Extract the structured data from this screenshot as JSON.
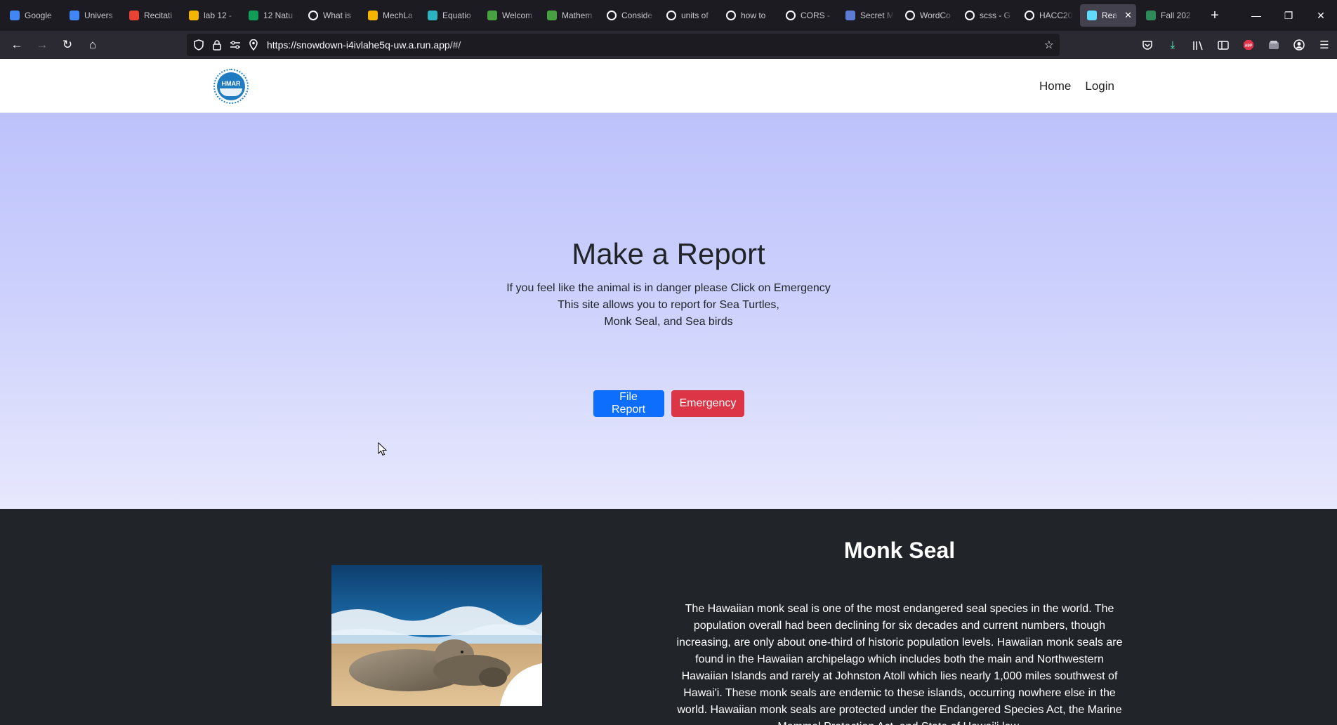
{
  "browser": {
    "tabs": [
      {
        "label": "Google",
        "icon": "google-docs-icon",
        "color": "#4285f4"
      },
      {
        "label": "Univers",
        "icon": "google-docs-icon",
        "color": "#4285f4"
      },
      {
        "label": "Recitati",
        "icon": "gmail-icon",
        "color": "#ea4335"
      },
      {
        "label": "lab 12 -",
        "icon": "google-drive-icon",
        "color": "#f4b400"
      },
      {
        "label": "12 Natu",
        "icon": "google-sheets-icon",
        "color": "#0f9d58"
      },
      {
        "label": "What is",
        "icon": "google-search-icon",
        "color": "#ffffff"
      },
      {
        "label": "MechLa",
        "icon": "google-drive-icon",
        "color": "#f4b400"
      },
      {
        "label": "Equatio",
        "icon": "equatio-icon",
        "color": "#2bb3c0"
      },
      {
        "label": "Welcom",
        "icon": "overleaf-icon",
        "color": "#47a141"
      },
      {
        "label": "Mathem",
        "icon": "overleaf-icon",
        "color": "#47a141"
      },
      {
        "label": "Conside",
        "icon": "google-search-icon",
        "color": "#ffffff"
      },
      {
        "label": "units of",
        "icon": "google-search-icon",
        "color": "#ffffff"
      },
      {
        "label": "how to",
        "icon": "google-search-icon",
        "color": "#ffffff"
      },
      {
        "label": "CORS -",
        "icon": "google-search-icon",
        "color": "#ffffff"
      },
      {
        "label": "Secret M",
        "icon": "shield-icon",
        "color": "#5b7bd5"
      },
      {
        "label": "WordCo",
        "icon": "wikipedia-icon",
        "color": "#ffffff"
      },
      {
        "label": "scss - G",
        "icon": "google-search-icon",
        "color": "#ffffff"
      },
      {
        "label": "HACC20",
        "icon": "github-icon",
        "color": "#ffffff"
      },
      {
        "label": "React",
        "icon": "react-icon",
        "color": "#61dafb",
        "active": true
      },
      {
        "label": "Fall 202",
        "icon": "globe-icon",
        "color": "#2e8b57"
      }
    ],
    "new_tab": "+",
    "url_host": "https://snowdown-i4ivlahe5q-uw.a.run.app",
    "url_path": "/#/"
  },
  "site": {
    "logo_text": "HMAR",
    "nav": {
      "home": "Home",
      "login": "Login"
    }
  },
  "hero": {
    "title": "Make a Report",
    "line1": "If you feel like the animal is in danger please Click on Emergency",
    "line2": "This site allows you to report for Sea Turtles,",
    "line3": "Monk Seal, and Sea birds",
    "file_report": "File Report",
    "emergency": "Emergency"
  },
  "info": {
    "title": "Monk Seal",
    "text": "The Hawaiian monk seal is one of the most endangered seal species in the world. The population overall had been declining for six decades and current numbers, though increasing, are only about one-third of historic population levels. Hawaiian monk seals are found in the Hawaiian archipelago which includes both the main and Northwestern Hawaiian Islands and rarely at Johnston Atoll which lies nearly 1,000 miles southwest of Hawai'i. These monk seals are endemic to these islands, occurring nowhere else in the world. Hawaiian monk seals are protected under the Endangered Species Act, the Marine Mammal Protection Act, and State of Hawai'i law."
  },
  "colors": {
    "primary": "#0d6efd",
    "danger": "#dc3545",
    "dark_section": "#212529",
    "hero_top": "#bdc2fb",
    "hero_bottom": "#e7e8fd"
  }
}
